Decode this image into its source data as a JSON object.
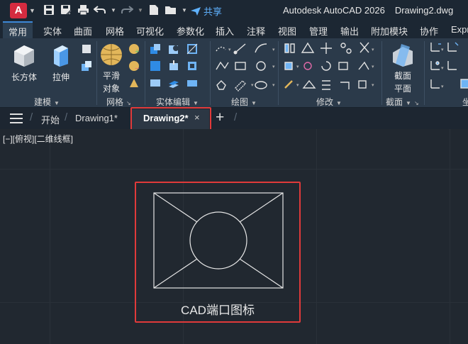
{
  "app": {
    "logo_letter": "A",
    "title": "Autodesk AutoCAD 2026",
    "document": "Drawing2.dwg",
    "share_label": "共享"
  },
  "menu_tabs": [
    "常用",
    "实体",
    "曲面",
    "网格",
    "可视化",
    "参数化",
    "插入",
    "注释",
    "视图",
    "管理",
    "输出",
    "附加模块",
    "协作",
    "Expr"
  ],
  "ribbon": {
    "big_buttons": {
      "box": "长方体",
      "extrude": "拉伸",
      "smooth_line1": "平滑",
      "smooth_line2": "对象",
      "section_line1": "截面",
      "section_line2": "平面"
    },
    "panels": [
      "建模",
      "网格",
      "实体编辑",
      "绘图",
      "修改",
      "截面",
      "坐"
    ]
  },
  "file_tabs": {
    "start": "开始",
    "drawing1": "Drawing1*",
    "drawing2": "Drawing2*",
    "close_glyph": "×",
    "new_tab_glyph": "+"
  },
  "viewport": {
    "label": "[−][俯视][二维线框]",
    "caption": "CAD端口图标"
  },
  "colors": {
    "highlight": "#e23a3a",
    "accent": "#3c87d6",
    "share": "#5fb2ff",
    "logo": "#d52b40"
  }
}
